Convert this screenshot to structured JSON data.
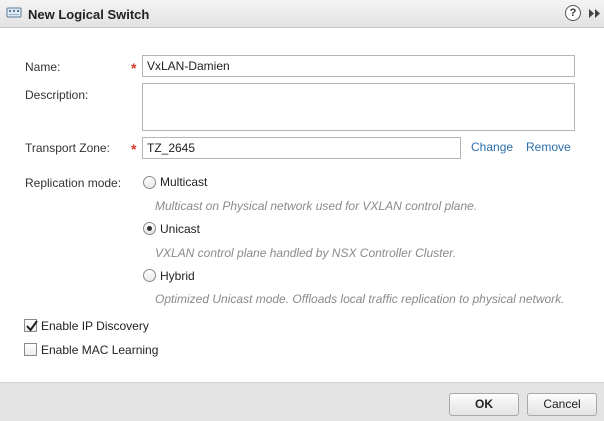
{
  "dialog": {
    "title": "New Logical Switch",
    "help_icon": "?"
  },
  "form": {
    "name": {
      "label": "Name:",
      "value": "VxLAN-Damien",
      "required": true
    },
    "description": {
      "label": "Description:",
      "value": ""
    },
    "transport_zone": {
      "label": "Transport Zone:",
      "value": "TZ_2645",
      "required": true,
      "change_link": "Change",
      "remove_link": "Remove"
    },
    "replication_mode": {
      "label": "Replication mode:",
      "selected": "Unicast",
      "options": [
        {
          "label": "Multicast",
          "description": "Multicast on Physical network used for VXLAN control plane.",
          "checked": false
        },
        {
          "label": "Unicast",
          "description": "VXLAN control plane handled by NSX Controller Cluster.",
          "checked": true
        },
        {
          "label": "Hybrid",
          "description": "Optimized Unicast mode. Offloads local traffic replication to physical network.",
          "checked": false
        }
      ]
    },
    "enable_ip_discovery": {
      "label": "Enable IP Discovery",
      "checked": true
    },
    "enable_mac_learning": {
      "label": "Enable MAC Learning",
      "checked": false
    }
  },
  "footer": {
    "ok_label": "OK",
    "cancel_label": "Cancel"
  },
  "colors": {
    "required_star": "#d9362a",
    "link": "#2a6ead",
    "description_text": "#8a8a8a"
  },
  "required_marker": "*"
}
